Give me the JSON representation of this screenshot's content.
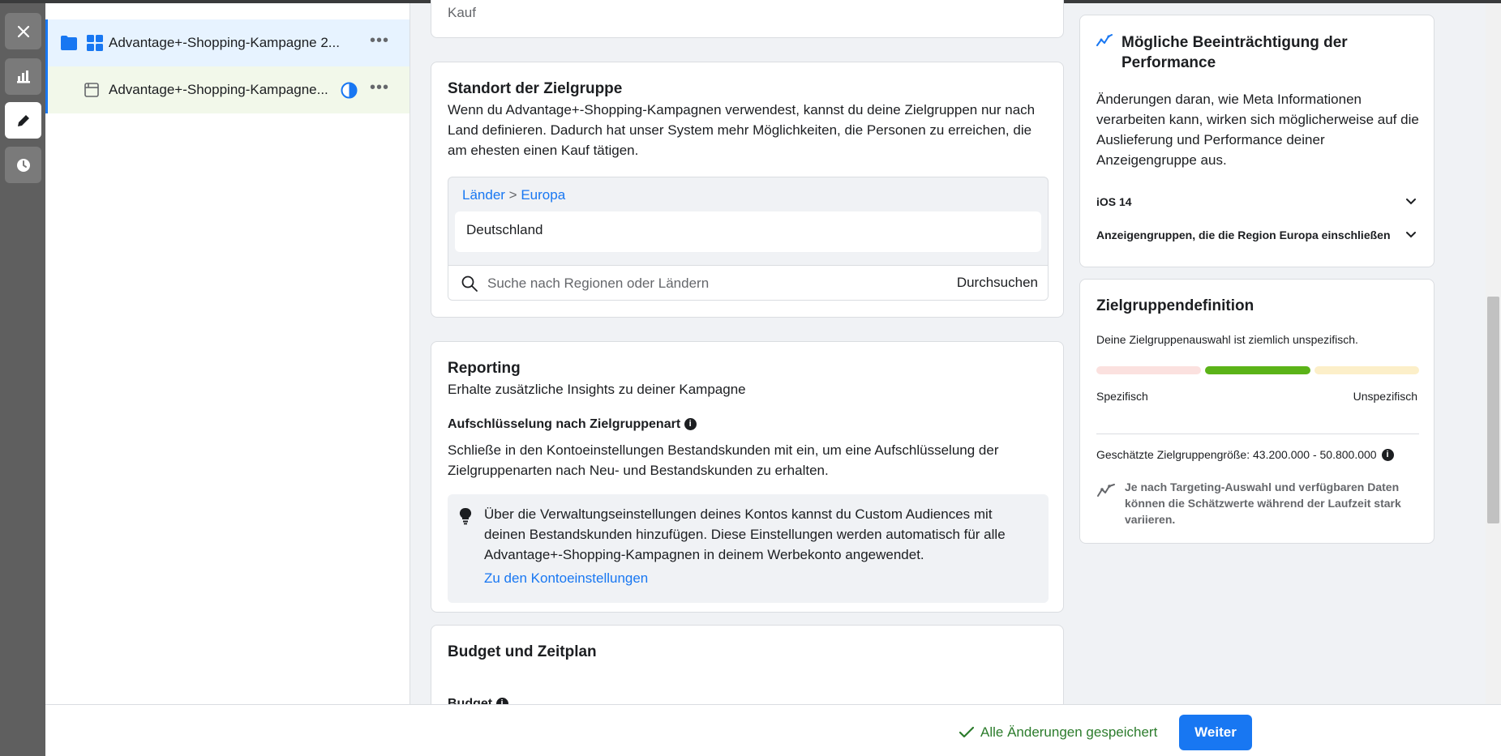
{
  "tree": {
    "campaign_label": "Advantage+-Shopping-Kampagne 2...",
    "adset_label": "Advantage+-Shopping-Kampagne...",
    "more_label": "•••"
  },
  "main": {
    "top_cut_text": "Kauf",
    "location": {
      "title": "Standort der Zielgruppe",
      "description": "Wenn du Advantage+-Shopping-Kampagnen verwendest, kannst du deine Zielgruppen nur nach Land definieren. Dadurch hat unser System mehr Möglichkeiten, die Personen zu erreichen, die am ehesten einen Kauf tätigen.",
      "crumb_1": "Länder",
      "crumb_sep": ">",
      "crumb_2": "Europa",
      "selected_country": "Deutschland",
      "search_placeholder": "Suche nach Regionen oder Ländern",
      "search_button": "Durchsuchen"
    },
    "reporting": {
      "title": "Reporting",
      "subtitle": "Erhalte zusätzliche Insights zu deiner Kampagne",
      "breakdown_title": "Aufschlüsselung nach Zielgruppenart",
      "breakdown_text": "Schließe in den Kontoeinstellungen Bestandskunden mit ein, um eine Aufschlüsselung der Zielgruppenarten nach Neu- und Bestandskunden zu erhalten.",
      "tip_text": "Über die Verwaltungseinstellungen deines Kontos kannst du Custom Audiences mit deinen Bestandskunden hinzufügen. Diese Einstellungen werden automatisch für alle Advantage+-Shopping-Kampagnen in deinem Werbekonto angewendet.",
      "tip_link": "Zu den Kontoeinstellungen"
    },
    "budget": {
      "title": "Budget und Zeitplan",
      "budget_label": "Budget"
    }
  },
  "side": {
    "perf": {
      "title": "Mögliche Beeinträchtigung der Performance",
      "text": "Änderungen daran, wie Meta Informationen verarbeiten kann, wirken sich möglicherweise auf die Auslieferung und Performance deiner Anzeigengruppe aus.",
      "acc_1": "iOS 14",
      "acc_2": "Anzeigengruppen, die die Region Europa einschließen"
    },
    "audience": {
      "title": "Zielgruppendefinition",
      "status": "Deine Zielgruppenauswahl ist ziemlich unspezifisch.",
      "level_index": 1,
      "level_colors": [
        "#fbe1df",
        "#5bb318",
        "#fcefc9"
      ],
      "label_left": "Spezifisch",
      "label_right": "Unspezifisch",
      "size_text": "Geschätzte Zielgruppengröße: 43.200.000 - 50.800.000",
      "note": "Je nach Targeting-Auswahl und verfügbaren Daten können die Schätzwerte während der Laufzeit stark variieren."
    }
  },
  "footer": {
    "saved_text": "Alle Änderungen gespeichert",
    "next_button": "Weiter"
  },
  "colors": {
    "accent": "#1877f2",
    "saved_green": "#2c7c2c"
  }
}
